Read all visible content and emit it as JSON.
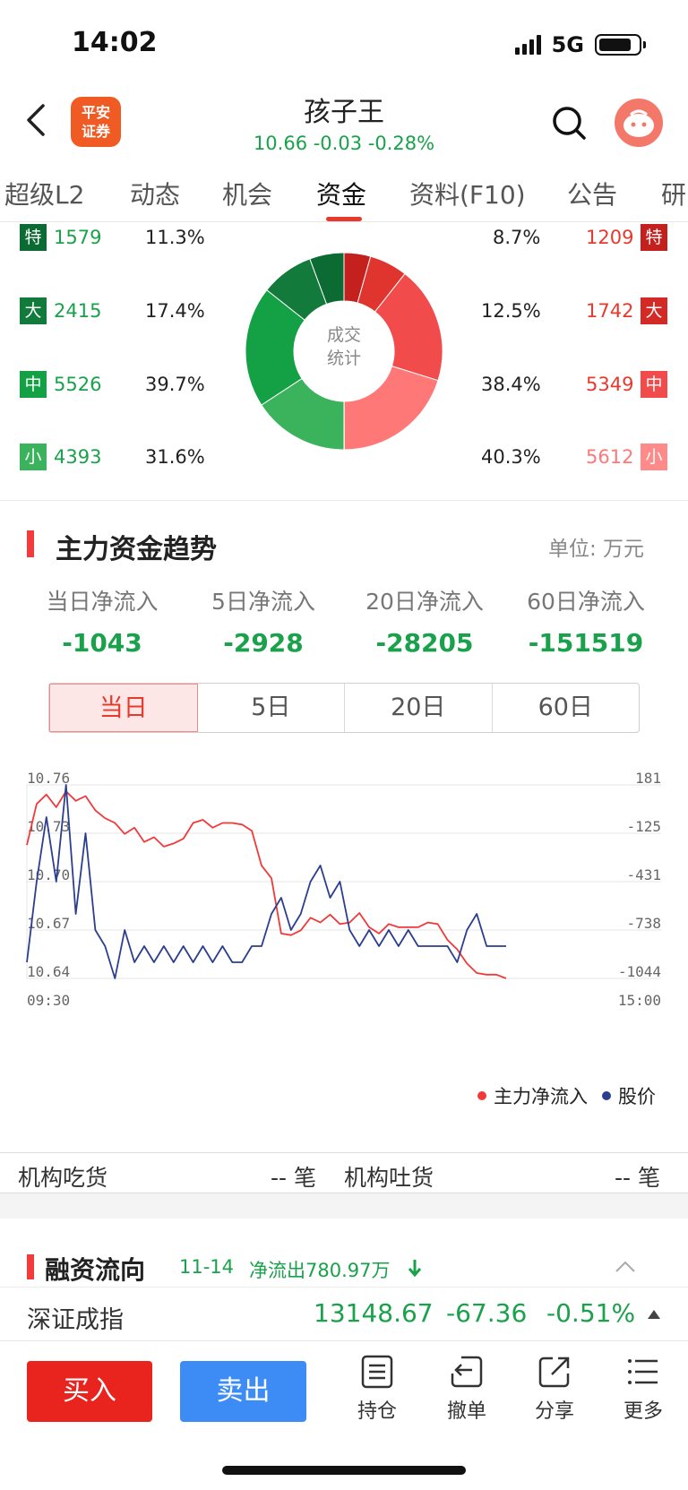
{
  "status": {
    "time": "14:02",
    "network": "5G"
  },
  "header": {
    "logo_line1": "平安",
    "logo_line2": "证券",
    "stock_name": "孩子王",
    "quote": "10.66 -0.03 -0.28%"
  },
  "tabs": [
    "超级L2",
    "动态",
    "机会",
    "资金",
    "资料(F10)",
    "公告",
    "研"
  ],
  "trade_stats": {
    "center_line1": "成交",
    "center_line2": "统计",
    "rows": [
      {
        "tag": "特",
        "left_count": "1579",
        "left_pct": "11.3%",
        "right_pct": "8.7%",
        "right_count": "1209"
      },
      {
        "tag": "大",
        "left_count": "2415",
        "left_pct": "17.4%",
        "right_pct": "12.5%",
        "right_count": "1742"
      },
      {
        "tag": "中",
        "left_count": "5526",
        "left_pct": "39.7%",
        "right_pct": "38.4%",
        "right_count": "5349"
      },
      {
        "tag": "小",
        "left_count": "4393",
        "left_pct": "31.6%",
        "right_pct": "40.3%",
        "right_count": "5612"
      }
    ],
    "colors": {
      "green_shades": [
        "#0b6b32",
        "#127a3a",
        "#14a044",
        "#3bb35c"
      ],
      "red_shades": [
        "#c4201d",
        "#e0342f",
        "#f24b4b",
        "#ff7878"
      ]
    }
  },
  "trend": {
    "title": "主力资金趋势",
    "unit": "单位:  万元",
    "flows": [
      {
        "label": "当日净流入",
        "value": "-1043"
      },
      {
        "label": "5日净流入",
        "value": "-2928"
      },
      {
        "label": "20日净流入",
        "value": "-28205"
      },
      {
        "label": "60日净流入",
        "value": "-151519"
      }
    ],
    "periods": [
      "当日",
      "5日",
      "20日",
      "60日"
    ],
    "legend": [
      "主力净流入",
      "股价"
    ]
  },
  "chart_data": {
    "type": "line",
    "x_start": "09:30",
    "x_end": "15:00",
    "y_left_ticks": [
      "10.76",
      "10.73",
      "10.70",
      "10.67",
      "10.64"
    ],
    "y_right_ticks": [
      "181",
      "-125",
      "-431",
      "-738",
      "-1044"
    ],
    "y_left_range": [
      10.64,
      10.76
    ],
    "y_right_range": [
      -1044,
      181
    ],
    "series": [
      {
        "name": "主力净流入",
        "color": "#f03a3a",
        "values": [
          -200,
          60,
          120,
          40,
          140,
          80,
          110,
          20,
          -30,
          -60,
          -130,
          -90,
          -180,
          -150,
          -210,
          -190,
          -160,
          -60,
          -40,
          -90,
          -60,
          -60,
          -70,
          -110,
          -330,
          -410,
          -760,
          -770,
          -740,
          -660,
          -690,
          -640,
          -700,
          -690,
          -630,
          -720,
          -760,
          -700,
          -720,
          -720,
          -720,
          -690,
          -700,
          -800,
          -860,
          -950,
          -1010,
          -1020,
          -1020,
          -1044
        ]
      },
      {
        "name": "股价",
        "color": "#2c3e8f",
        "values": [
          10.65,
          10.7,
          10.74,
          10.7,
          10.76,
          10.68,
          10.73,
          10.67,
          10.66,
          10.64,
          10.67,
          10.65,
          10.66,
          10.65,
          10.66,
          10.65,
          10.66,
          10.65,
          10.66,
          10.65,
          10.66,
          10.65,
          10.65,
          10.66,
          10.66,
          10.68,
          10.69,
          10.67,
          10.68,
          10.7,
          10.71,
          10.69,
          10.7,
          10.67,
          10.66,
          10.67,
          10.66,
          10.67,
          10.66,
          10.67,
          10.66,
          10.66,
          10.66,
          10.66,
          10.65,
          10.67,
          10.68,
          10.66,
          10.66,
          10.66
        ]
      }
    ]
  },
  "institution": {
    "eat_label": "机构吃货",
    "eat_value": "-- 笔",
    "spit_label": "机构吐货",
    "spit_value": "-- 笔"
  },
  "margin": {
    "title": "融资流向",
    "date": "11-14",
    "net": "净流出780.97万"
  },
  "index": {
    "name": "深证成指",
    "value": "13148.67",
    "change": "-67.36",
    "pct": "-0.51%"
  },
  "bottom": {
    "buy": "买入",
    "sell": "卖出",
    "actions": [
      "持仓",
      "撤单",
      "分享",
      "更多"
    ]
  }
}
